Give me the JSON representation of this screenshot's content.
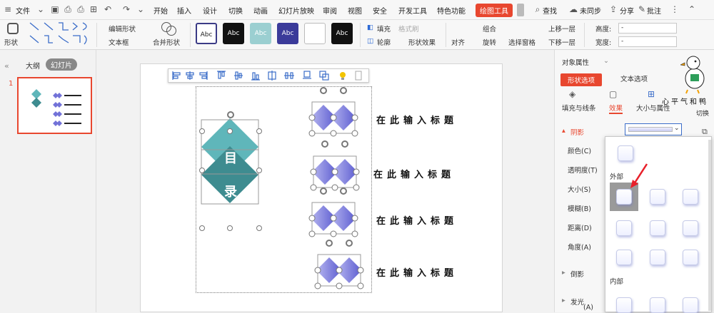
{
  "menubar": {
    "file_label": "文件",
    "tabs": [
      "开始",
      "插入",
      "设计",
      "切换",
      "动画",
      "幻灯片放映",
      "审阅",
      "视图",
      "安全",
      "开发工具",
      "特色功能"
    ],
    "active_tab": "绘图工具",
    "search_label": "查找",
    "sync_label": "未同步",
    "share_label": "分享",
    "annotate_label": "批注"
  },
  "ribbon": {
    "shape_label": "形状",
    "edit_shape_label": "编辑形状",
    "textbox_label": "文本框",
    "merge_shape_label": "合并形状",
    "style_samples": [
      "Abc",
      "Abc",
      "Abc",
      "Abc",
      "",
      "Abc"
    ],
    "fill_label": "填充",
    "outline_label": "轮廓",
    "format_brush_label": "格式刷",
    "shape_effect_label": "形状效果",
    "align_label": "对齐",
    "group_label": "组合",
    "rotate_label": "旋转",
    "selection_pane_label": "选择窗格",
    "bring_forward_label": "上移一层",
    "send_backward_label": "下移一层",
    "height_label": "高度:",
    "width_label": "宽度:",
    "height_value": "-",
    "width_value": "-"
  },
  "leftpane": {
    "tab_outline": "大纲",
    "tab_slides": "幻灯片",
    "slide_number": "1"
  },
  "slide": {
    "title_items": [
      "在此输入标题",
      "在此输入标题",
      "在此输入标题",
      "在此输入标题"
    ],
    "diamond_top_char": "目",
    "diamond_bottom_char": "录"
  },
  "rightpane": {
    "header": "对象属性",
    "tab_shape": "形状选项",
    "tab_text": "文本选项",
    "sub_fill": "填充与线条",
    "sub_effect": "效果",
    "sub_size": "大小与属性",
    "section_shadow": "阴影",
    "props": [
      "颜色(C)",
      "透明度(T)",
      "大小(S)",
      "模糊(B)",
      "距离(D)",
      "角度(A)"
    ],
    "section_reflect": "倒影",
    "section_glow": "发光",
    "glow_sub": "(A)",
    "side_label": "切换",
    "watermark": "心平气和鸭"
  },
  "popup": {
    "outer_label": "外部",
    "inner_label": "内部"
  },
  "colors": {
    "accent": "#e8472f",
    "teal_light": "#5fb6ba",
    "teal_dark": "#3e8c90",
    "purple": "#6f6fd6"
  }
}
